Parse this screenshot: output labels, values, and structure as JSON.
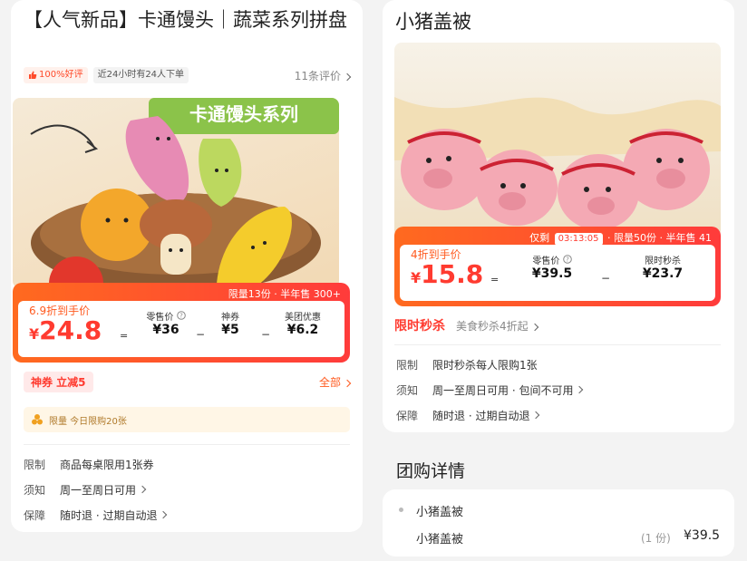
{
  "left": {
    "title": "【人气新品】卡通馒头｜蔬菜系列拼盘",
    "good_rate": "100%好评",
    "recent_orders": "近24小时有24人下单",
    "reviews": "11条评价",
    "banner_text": "卡通馒头系列",
    "strip": "限量13份 · 半年售 300+",
    "deal_label": "6.9折到手价",
    "price": "24.8",
    "eq": "=",
    "retail_label": "零售价",
    "retail_value": "¥36",
    "coupon_label": "神券",
    "coupon_value": "¥5",
    "mt_label": "美团优惠",
    "mt_value": "¥6.2",
    "shenquan": "神券 立减5",
    "all": "全部",
    "limit_text": "限量   今日限购20张",
    "rules": [
      {
        "k": "限制",
        "v": "商品每桌限用1张券"
      },
      {
        "k": "须知",
        "v": "周一至周日可用"
      },
      {
        "k": "保障",
        "v": "随时退 · 过期自动退"
      }
    ]
  },
  "right": {
    "title": "小猪盖被",
    "strip_prefix": "仅剩",
    "timer": "03:13:05",
    "strip_suffix": "· 限量50份 · 半年售 41",
    "deal_label": "4折到手价",
    "price": "15.8",
    "eq": "=",
    "retail_label": "零售价",
    "retail_value": "¥39.5",
    "flash_label": "限时秒杀",
    "flash_value": "¥23.7",
    "flash_brand": "限时秒杀",
    "flash_sub": "美食秒杀4折起",
    "rules": [
      {
        "k": "限制",
        "v": "限时秒杀每人限购1张"
      },
      {
        "k": "须知",
        "v": "周一至周日可用 · 包间不可用"
      },
      {
        "k": "保障",
        "v": "随时退 · 过期自动退"
      }
    ]
  },
  "detail": {
    "section_title": "团购详情",
    "group_name": "小猪盖被",
    "item_name": "小猪盖被",
    "qty": "(1 份)",
    "price": "¥39.5"
  },
  "colors": {
    "accent": "#ff3b30",
    "orange": "#ff6a1f",
    "green_banner": "#8bc34a"
  },
  "icons": [
    "thumb-up-icon",
    "chevron-right-icon",
    "help-circle-icon",
    "coupon-dots-icon"
  ]
}
